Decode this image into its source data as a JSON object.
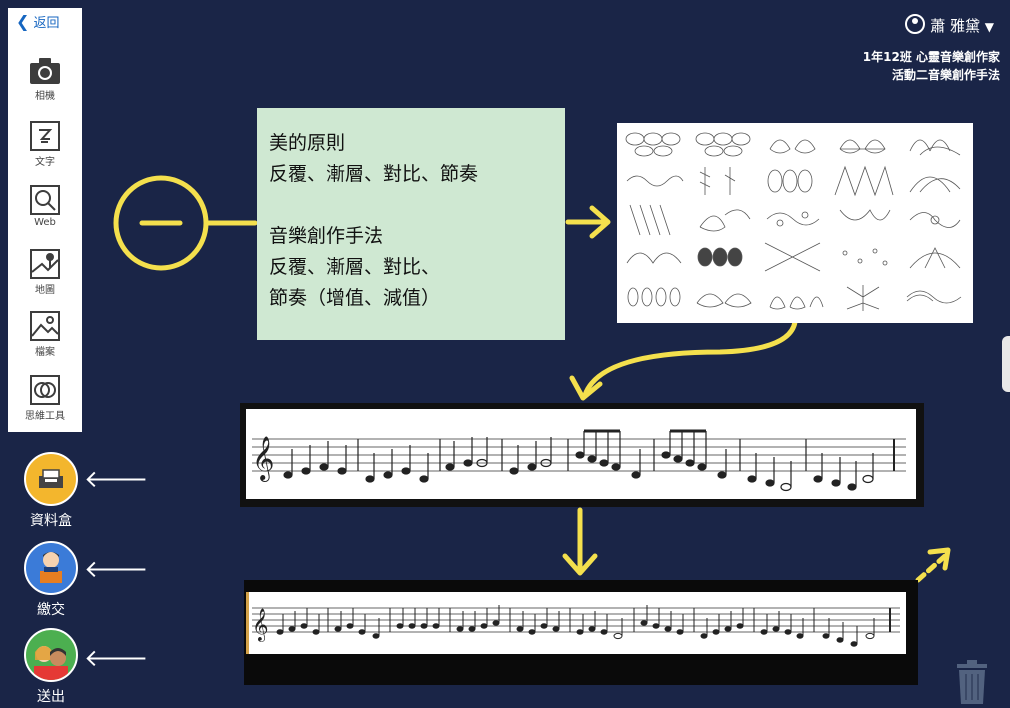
{
  "nav": {
    "back_label": "返回"
  },
  "toolbar": {
    "items": [
      {
        "label": "相機",
        "icon": "camera-icon"
      },
      {
        "label": "文字",
        "icon": "text-icon"
      },
      {
        "label": "Web",
        "icon": "web-search-icon"
      },
      {
        "label": "地圖",
        "icon": "map-icon"
      },
      {
        "label": "檔案",
        "icon": "file-image-icon"
      },
      {
        "label": "思維工具",
        "icon": "thinking-tools-icon"
      }
    ]
  },
  "actions": [
    {
      "label": "資料盒",
      "icon": "data-box-icon"
    },
    {
      "label": "繳交",
      "icon": "submit-icon"
    },
    {
      "label": "送出",
      "icon": "send-icon"
    }
  ],
  "user": {
    "name": "蕭 雅黛"
  },
  "course": {
    "class_title": "1年12班 心靈音樂創作家",
    "activity_title": "活動二音樂創作手法"
  },
  "card": {
    "heading1": "美的原則",
    "line1": "反覆、漸層、對比、節奏",
    "heading2": "音樂創作手法",
    "line2": "反覆、漸層、對比、",
    "line3": "節奏（增值、減值）"
  },
  "colors": {
    "background": "#1a2547",
    "card": "#cfe8d2",
    "arrow": "#f4e04d",
    "back_link": "#1565c0"
  }
}
